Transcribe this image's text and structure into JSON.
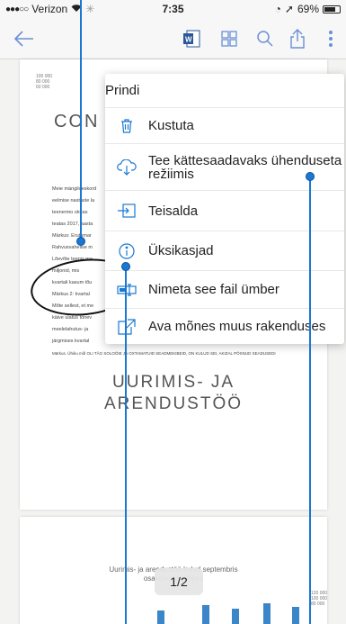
{
  "status_bar": {
    "carrier": "Verizon",
    "time": "7:35",
    "battery": "69%"
  },
  "toolbar": {
    "icons": [
      "back-arrow-icon",
      "word-icon",
      "grid-view-icon",
      "search-icon",
      "share-icon",
      "more-icon"
    ]
  },
  "document": {
    "title": "CON",
    "paragraphs": [
      "Meie mängiloeskord",
      "eelmise nastaste la",
      "teenermo olotas",
      "teatas 2017, aasta",
      "Märkus: Erutomar",
      "Rahvusvahelise m",
      "Lõevõte teenis ma",
      "miljonid, mis",
      "kvartali kasum tõu",
      "Märkus 2: kvartal",
      "Mõte sellest, et me",
      "käive ulatus tõnev",
      "meelelahutus- ja",
      "järgmises kvartal"
    ],
    "footnote": "Märkus. Ühiku mõl OLI TÄG SOLOÖIE JA OXTAMATUID SEADMEKIBEID, ON KULUD SEI, AKIZAL PÖSNUD SEADUSEDI",
    "section_heading_line1": "UURIMIS- JA",
    "section_heading_line2": "ARENDUSTÖÖ"
  },
  "chart": {
    "title_line1": "Uurimis- ja arendustöö kulud septembris",
    "title_line2": "osakondade lõikes",
    "left_ticks": [
      "100 000",
      "80 000",
      "60 000"
    ],
    "right_ticks": [
      "120 000",
      "100 000",
      "80 000"
    ]
  },
  "page_indicator": "1/2",
  "menu": {
    "items": [
      {
        "label": "Prindi",
        "icon": "none"
      },
      {
        "label": "Kustuta",
        "icon": "trash-icon"
      },
      {
        "label": "Tee kättesaadavaks ühenduseta režiimis",
        "icon": "cloud-download-icon"
      },
      {
        "label": "Teisalda",
        "icon": "move-icon"
      },
      {
        "label": "Üksikasjad",
        "icon": "info-icon"
      },
      {
        "label": "Nimeta see fail ümber",
        "icon": "rename-icon"
      },
      {
        "label": "Ava mõnes muus rakenduses",
        "icon": "open-in-icon"
      }
    ]
  },
  "colors": {
    "accent": "#1a78d2",
    "background": "#f3f3f1",
    "menu_background": "#ffffff"
  }
}
